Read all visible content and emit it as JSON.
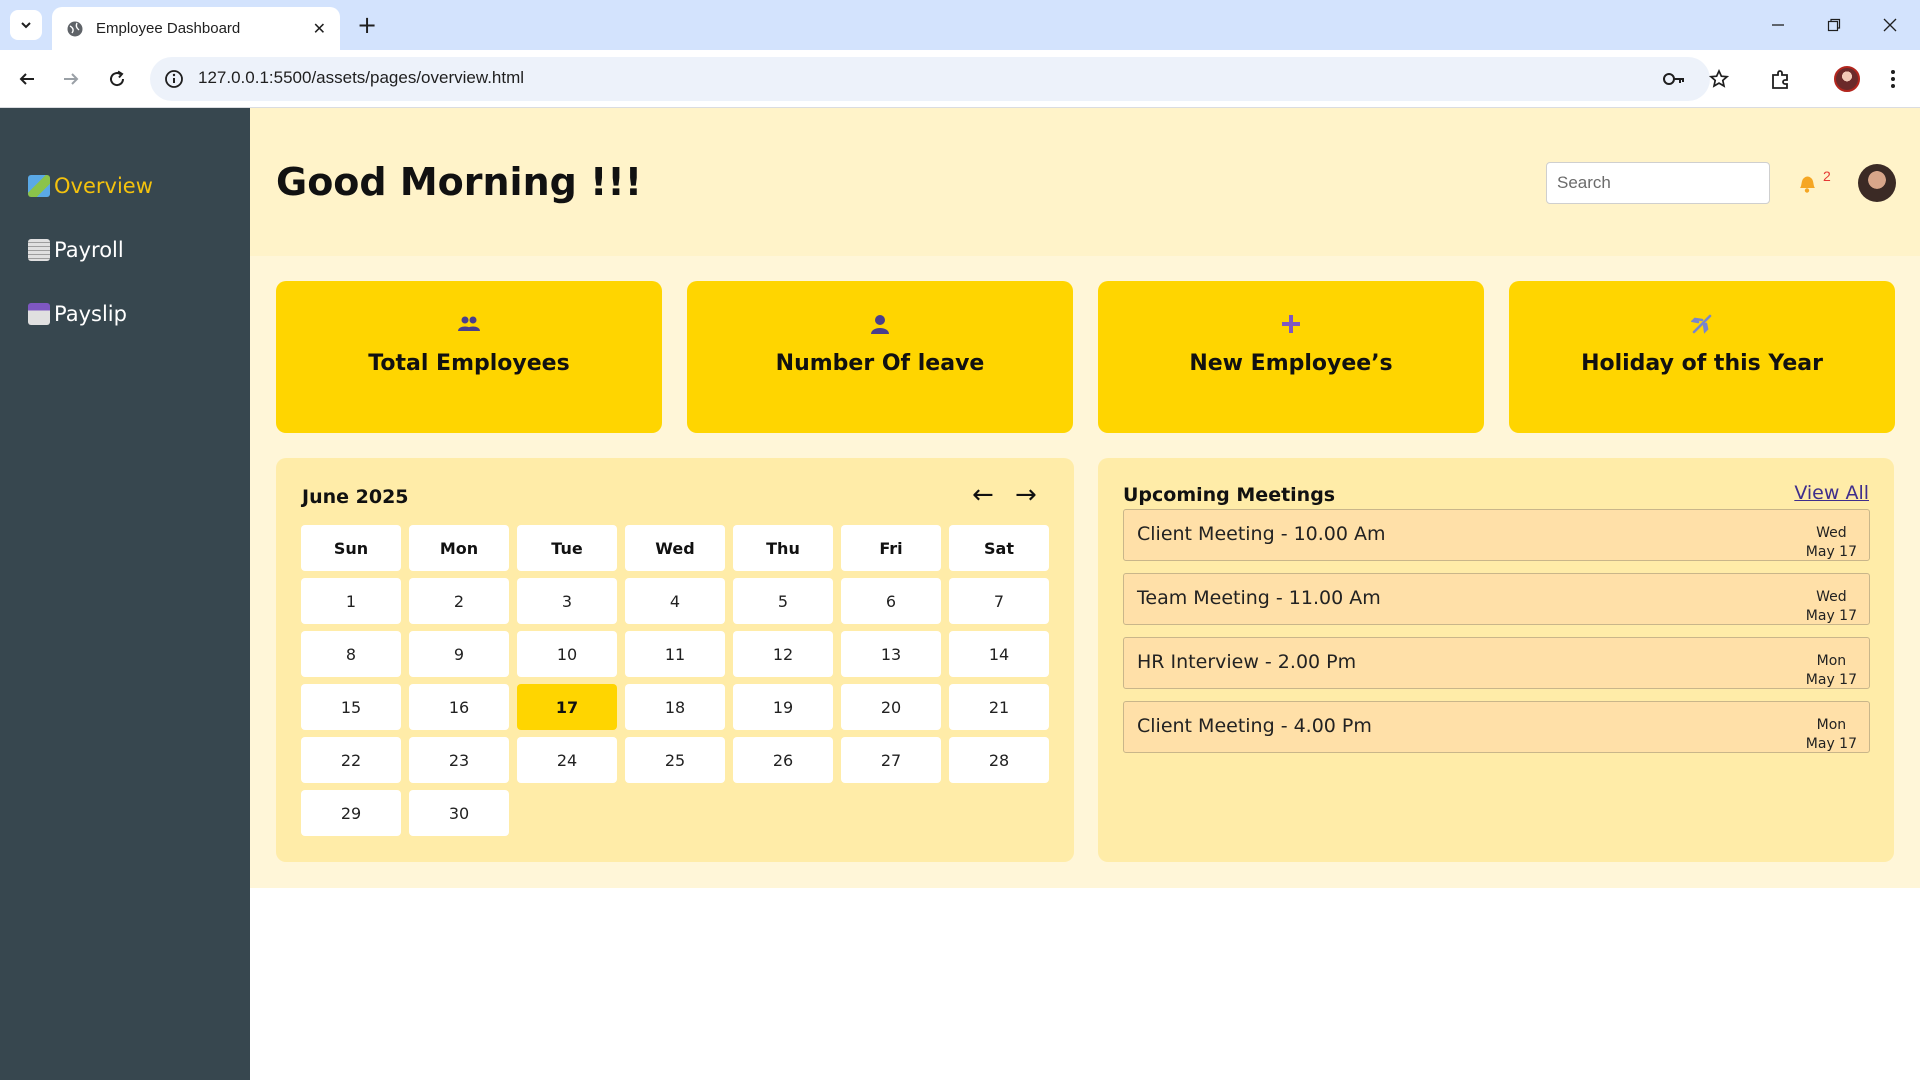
{
  "browser": {
    "tab_title": "Employee Dashboard",
    "tab_close": "✕",
    "new_tab": "+",
    "url": "127.0.0.1:5500/assets/pages/overview.html"
  },
  "sidebar": {
    "items": [
      {
        "label": "Overview",
        "icon": "map-icon",
        "active": true
      },
      {
        "label": "Payroll",
        "icon": "receipt-icon",
        "active": false
      },
      {
        "label": "Payslip",
        "icon": "calendar-icon",
        "active": false
      }
    ]
  },
  "header": {
    "greeting": "Good Morning !!!",
    "search_placeholder": "Search",
    "notification_count": "2"
  },
  "cards": [
    {
      "label": "Total Employees",
      "icon": "group-icon"
    },
    {
      "label": "Number Of leave",
      "icon": "person-icon"
    },
    {
      "label": "New Employee’s",
      "icon": "plus-icon"
    },
    {
      "label": "Holiday of this Year",
      "icon": "airplane-icon"
    }
  ],
  "calendar": {
    "title": "June 2025",
    "prev": "←",
    "next": "→",
    "weekdays": [
      "Sun",
      "Mon",
      "Tue",
      "Wed",
      "Thu",
      "Fri",
      "Sat"
    ],
    "days": [
      "1",
      "2",
      "3",
      "4",
      "5",
      "6",
      "7",
      "8",
      "9",
      "10",
      "11",
      "12",
      "13",
      "14",
      "15",
      "16",
      "17",
      "18",
      "19",
      "20",
      "21",
      "22",
      "23",
      "24",
      "25",
      "26",
      "27",
      "28",
      "29",
      "30"
    ],
    "today": "17"
  },
  "meetings": {
    "title": "Upcoming Meetings",
    "view_all": "View All",
    "items": [
      {
        "name": "Client Meeting - 10.00 Am",
        "day": "Wed",
        "date": "May 17"
      },
      {
        "name": "Team Meeting - 11.00 Am",
        "day": "Wed",
        "date": "May 17"
      },
      {
        "name": "HR Interview - 2.00 Pm",
        "day": "Mon",
        "date": "May 17"
      },
      {
        "name": "Client Meeting - 4.00 Pm",
        "day": "Mon",
        "date": "May 17"
      }
    ]
  },
  "colors": {
    "accent": "#ffd500",
    "sidebar": "#37474f",
    "active_nav": "#f4c20d",
    "panel": "#ffeca8"
  }
}
